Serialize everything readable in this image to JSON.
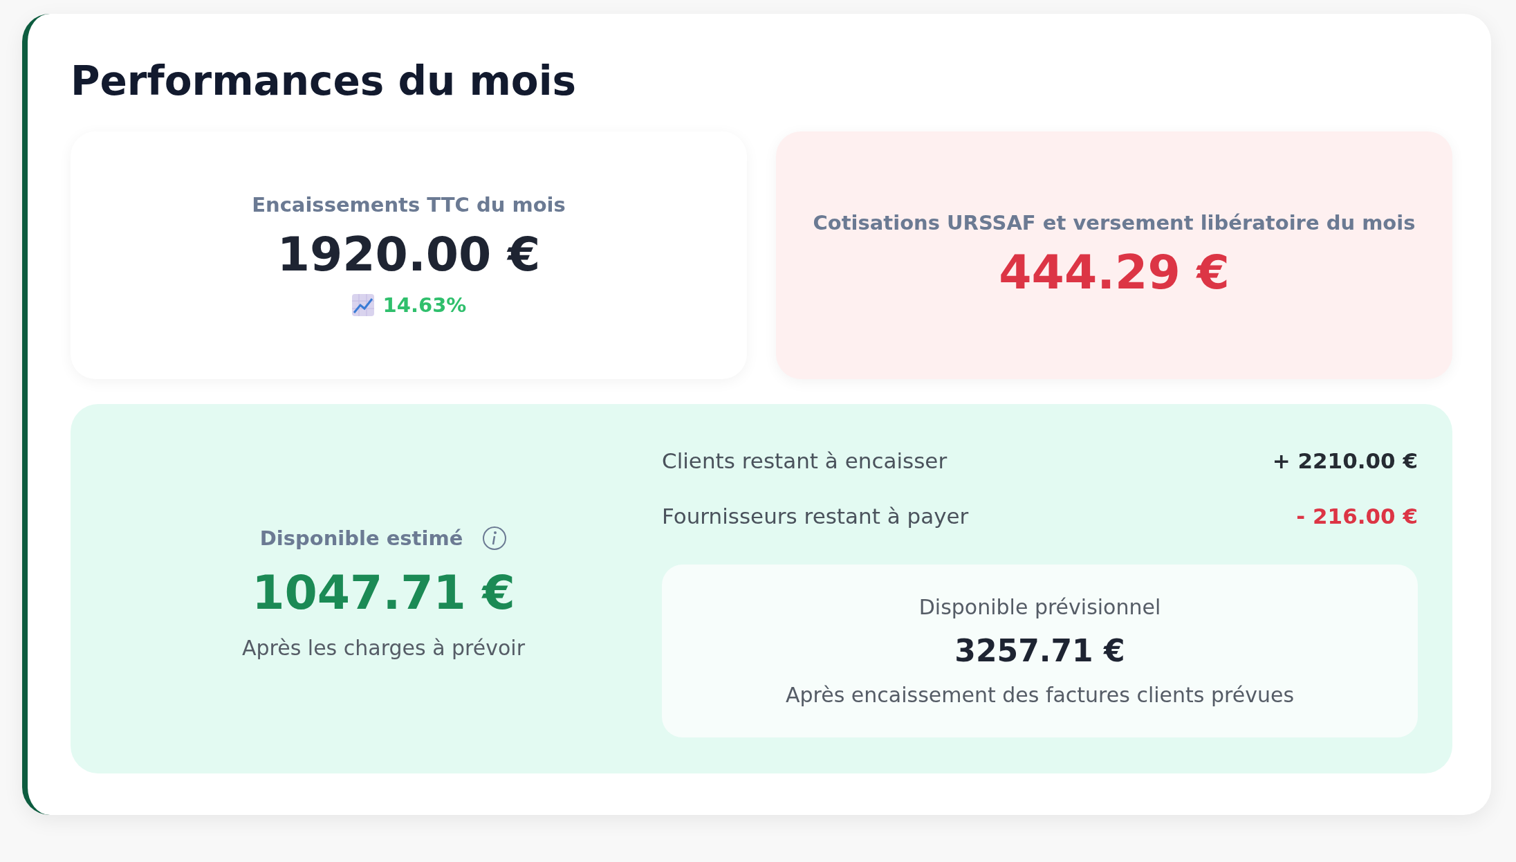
{
  "title": "Performances du mois",
  "cards": [
    {
      "kind": "plain",
      "color": "#1e2432",
      "label": "Encaissements TTC du mois",
      "value": "1920.00 €",
      "change": {
        "kind": "rising",
        "value": "14.63%"
      }
    },
    {
      "kind": "alert",
      "color": "#dc3545",
      "label": "Cotisations URSSAF et versement libératoire du mois",
      "value": "444.29 €"
    }
  ],
  "available": {
    "label": "Disponible estimé",
    "value": "1047.71 €",
    "note": "Après les charges à prévoir",
    "rows": [
      {
        "label": "Clients restant à encaisser",
        "amount": "+ 2210.00 €",
        "color": "#262b33"
      },
      {
        "label": "Fournisseurs restant à payer",
        "amount": "- 216.00 €",
        "color": "#dc3545"
      }
    ],
    "forecast": {
      "label": "Disponible prévisionnel",
      "value": "3257.71 €",
      "note": "Après encaissement des factures clients prévues"
    }
  }
}
